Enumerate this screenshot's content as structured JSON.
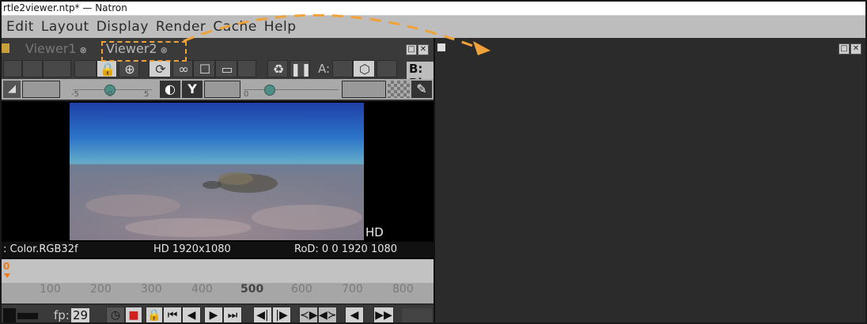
{
  "window": {
    "title": "rtle2viewer.ntp* — Natron"
  },
  "menubar": {
    "items": [
      "Edit",
      "Layout",
      "Display",
      "Render",
      "Cache",
      "Help"
    ]
  },
  "tabs": [
    {
      "label": "Viewer1"
    },
    {
      "label": "Viewer2"
    }
  ],
  "viewer_toolbar": {
    "a_label": "A:",
    "b_label": "B: Bl"
  },
  "gain_slider": {
    "ticks": [
      "-5",
      "0",
      "5"
    ],
    "gamma_tick": "0"
  },
  "viewer": {
    "format_badge": "HD",
    "info": {
      "channels": ": Color.RGB32f",
      "format": "HD 1920x1080",
      "rod": "RoD: 0 0 1920 1080"
    }
  },
  "timeline": {
    "marker": "0",
    "frames": [
      "100",
      "200",
      "300",
      "400",
      "500",
      "600",
      "700",
      "800"
    ]
  },
  "playback": {
    "fps_label": "fp:",
    "fps_value": "29"
  },
  "colors": {
    "accent_dash": "#f0a23a",
    "timeline_marker": "#f07a1a",
    "knob": "#4e8c86"
  }
}
